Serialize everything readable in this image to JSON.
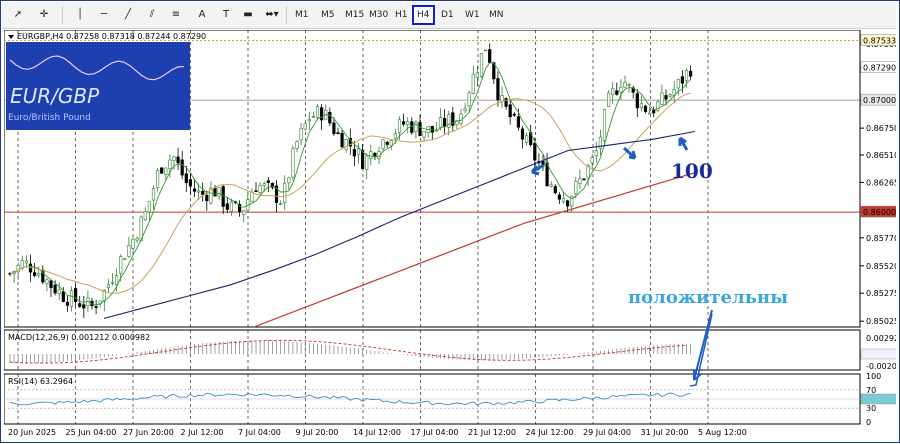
{
  "toolbar": {
    "timeframes": [
      "M1",
      "M5",
      "M15",
      "M30",
      "H1",
      "H4",
      "D1",
      "W1",
      "MN"
    ],
    "active_timeframe": "H4",
    "text_tool_label": "A",
    "label_tool_label": "T"
  },
  "symbol_header": "EURGBP,H4  0.87258 0.87318 0.87244 0.87290",
  "logo": {
    "title": "EUR/GBP",
    "subtitle": "Euro/British Pound"
  },
  "annotations": {
    "ma_period": "100",
    "word": "положительны"
  },
  "colors": {
    "bull": "#2f7f2f",
    "bear": "#000000",
    "ma_fast": "#2e9b2e",
    "ma_mid": "#c9a25a",
    "ma_slow": "#1a1f6e",
    "ma_long": "#c0392b",
    "rsi": "#3b8fc4",
    "macd": "#c0392b",
    "arrow": "#1f5fbf",
    "hline": "#c0392b",
    "level": "#808080",
    "dotted_level": "#c9a050"
  },
  "price_axis": {
    "ticks": [
      "0.87500",
      "0.87290",
      "0.87000",
      "0.86750",
      "0.86510",
      "0.86265",
      "0.86000",
      "0.85770",
      "0.85520",
      "0.85275",
      "0.85025"
    ],
    "current_price": "0.87290",
    "dotted_level_label": "0.87533",
    "level_87000_label": "0.87000",
    "red_level_label": "0.86000"
  },
  "time_axis": [
    "20 Jun 2025",
    "25 Jun 04:00",
    "27 Jun 20:00",
    "2 Jul 12:00",
    "7 Jul 04:00",
    "9 Jul 20:00",
    "14 Jul 12:00",
    "17 Jul 04:00",
    "21 Jul 12:00",
    "24 Jul 12:00",
    "29 Jul 04:00",
    "31 Jul 20:00",
    "5 Aug 12:00"
  ],
  "macd": {
    "label": "MACD(12,26,9) 0.001212 0.000982",
    "ticks": [
      "0.002926",
      "0.000000",
      "-0.00204"
    ]
  },
  "rsi": {
    "label": "RSI(14) 63.2964",
    "ticks": [
      "100",
      "70",
      "50.0000",
      "30",
      "0"
    ]
  },
  "chart_data": {
    "type": "candlestick",
    "symbol": "EURGBP",
    "timeframe": "H4",
    "ylim": [
      0.85,
      0.876
    ],
    "x": [
      "20 Jun 2025",
      "25 Jun 04:00",
      "27 Jun 20:00",
      "2 Jul 12:00",
      "7 Jul 04:00",
      "9 Jul 20:00",
      "14 Jul 12:00",
      "17 Jul 04:00",
      "21 Jul 12:00",
      "24 Jul 12:00",
      "29 Jul 04:00",
      "31 Jul 20:00",
      "5 Aug 12:00"
    ],
    "close_path": [
      0.8545,
      0.8555,
      0.8548,
      0.8535,
      0.8525,
      0.852,
      0.8515,
      0.853,
      0.8555,
      0.8575,
      0.86,
      0.864,
      0.865,
      0.8625,
      0.8615,
      0.862,
      0.8605,
      0.86,
      0.8625,
      0.862,
      0.861,
      0.866,
      0.8685,
      0.869,
      0.867,
      0.866,
      0.8645,
      0.866,
      0.867,
      0.868,
      0.8675,
      0.8672,
      0.868,
      0.8685,
      0.872,
      0.875,
      0.87,
      0.868,
      0.866,
      0.864,
      0.862,
      0.8612,
      0.863,
      0.865,
      0.87,
      0.872,
      0.87,
      0.869,
      0.87,
      0.8712,
      0.8729
    ],
    "levels": [
      0.87533,
      0.87,
      0.86
    ],
    "series": [
      {
        "name": "MA 100",
        "values": [
          0.8505,
          0.8515,
          0.8525,
          0.8535,
          0.8548,
          0.8562,
          0.8578,
          0.8595,
          0.861,
          0.8625,
          0.864,
          0.8655,
          0.866,
          0.8665,
          0.8672
        ]
      }
    ]
  }
}
